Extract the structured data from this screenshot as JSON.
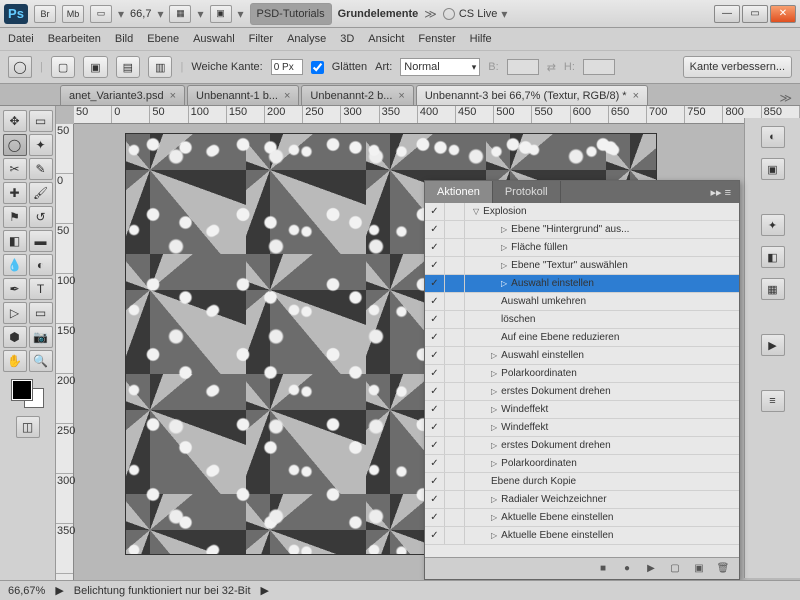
{
  "top": {
    "zoom": "66,7",
    "psd": "PSD-Tutorials",
    "workspace": "Grundelemente",
    "cslive": "CS Live"
  },
  "menu": [
    "Datei",
    "Bearbeiten",
    "Bild",
    "Ebene",
    "Auswahl",
    "Filter",
    "Analyse",
    "3D",
    "Ansicht",
    "Fenster",
    "Hilfe"
  ],
  "options": {
    "weiche": "Weiche Kante:",
    "weiche_val": "0 Px",
    "glatten": "Glätten",
    "art": "Art:",
    "art_val": "Normal",
    "b": "B:",
    "h": "H:",
    "refine": "Kante verbessern..."
  },
  "tabs": [
    {
      "label": "anet_Variante3.psd",
      "active": false
    },
    {
      "label": "Unbenannt-1 b...",
      "active": false
    },
    {
      "label": "Unbenannt-2 b...",
      "active": false
    },
    {
      "label": "Unbenannt-3 bei 66,7% (Textur, RGB/8) *",
      "active": true
    }
  ],
  "rulerH": [
    "50",
    "0",
    "50",
    "100",
    "150",
    "200",
    "250",
    "300",
    "350",
    "400",
    "450",
    "500",
    "550",
    "600",
    "650",
    "700",
    "750",
    "800",
    "850"
  ],
  "rulerV": [
    "50",
    "0",
    "50",
    "100",
    "150",
    "200",
    "250",
    "300",
    "350"
  ],
  "panel": {
    "tab1": "Aktionen",
    "tab2": "Protokoll",
    "set": "Explosion",
    "items": [
      {
        "t": "Ebene \"Hintergrund\" aus...",
        "p": true,
        "i": 36
      },
      {
        "t": "Fläche füllen",
        "p": true,
        "i": 36
      },
      {
        "t": "Ebene \"Textur\" auswählen",
        "p": true,
        "i": 36
      },
      {
        "t": "Auswahl einstellen",
        "p": true,
        "i": 36,
        "sel": true
      },
      {
        "t": "Auswahl umkehren",
        "p": false,
        "i": 36
      },
      {
        "t": "löschen",
        "p": false,
        "i": 36
      },
      {
        "t": "Auf eine Ebene reduzieren",
        "p": false,
        "i": 36
      },
      {
        "t": "Auswahl einstellen",
        "p": true,
        "i": 26
      },
      {
        "t": "Polarkoordinaten",
        "p": true,
        "i": 26
      },
      {
        "t": "erstes Dokument drehen",
        "p": true,
        "i": 26
      },
      {
        "t": "Windeffekt",
        "p": true,
        "i": 26
      },
      {
        "t": "Windeffekt",
        "p": true,
        "i": 26
      },
      {
        "t": "erstes Dokument drehen",
        "p": true,
        "i": 26
      },
      {
        "t": "Polarkoordinaten",
        "p": true,
        "i": 26
      },
      {
        "t": "Ebene durch Kopie",
        "p": false,
        "i": 26
      },
      {
        "t": "Radialer Weichzeichner",
        "p": true,
        "i": 26
      },
      {
        "t": "Aktuelle Ebene einstellen",
        "p": true,
        "i": 26
      },
      {
        "t": "Aktuelle Ebene einstellen",
        "p": true,
        "i": 26
      }
    ]
  },
  "status": {
    "zoom": "66,67%",
    "msg": "Belichtung funktioniert nur bei 32-Bit"
  }
}
